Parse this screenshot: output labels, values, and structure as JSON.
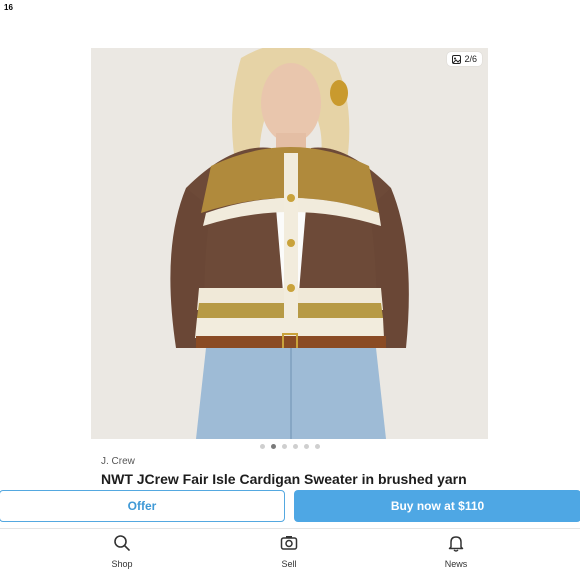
{
  "status_bar": {
    "time": "16"
  },
  "listing": {
    "photo_counter": "2/6",
    "carousel": {
      "total": 6,
      "active_index": 1
    },
    "brand": "J. Crew",
    "title": "NWT JCrew Fair Isle Cardigan Sweater in brushed yarn"
  },
  "actions": {
    "offer_label": "Offer",
    "buy_label": "Buy now at $110"
  },
  "tabbar": {
    "items": [
      {
        "label": "Shop",
        "icon": "search-icon"
      },
      {
        "label": "Sell",
        "icon": "camera-icon"
      },
      {
        "label": "News",
        "icon": "bell-icon"
      }
    ]
  },
  "colors": {
    "accent": "#4ea7e4",
    "accent_text": "#3f99d6"
  }
}
